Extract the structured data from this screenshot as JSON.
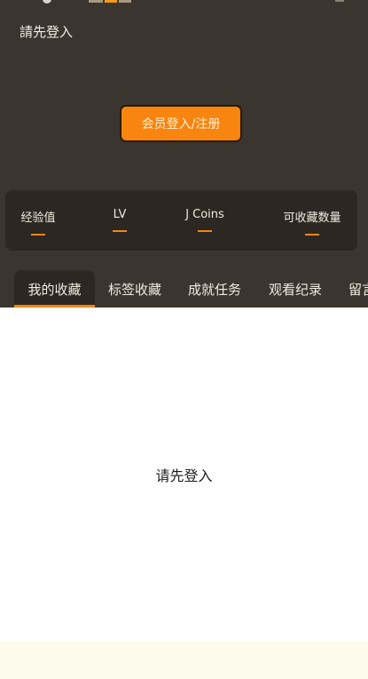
{
  "header": {
    "login_prompt": "請先登入",
    "login_button": "会员登入/注册"
  },
  "stats": [
    {
      "label": "经验值"
    },
    {
      "label": "LV"
    },
    {
      "label": "J Coins"
    },
    {
      "label": "可收藏数量"
    }
  ],
  "tabs": [
    {
      "label": "我的收藏"
    },
    {
      "label": "标签收藏"
    },
    {
      "label": "成就任务"
    },
    {
      "label": "观看纪录"
    },
    {
      "label": "留言"
    }
  ],
  "content": {
    "empty_message": "请先登入"
  },
  "colors": {
    "accent": "#f7850f",
    "header_bg": "#3b3530",
    "card_bg": "#2c2722"
  }
}
